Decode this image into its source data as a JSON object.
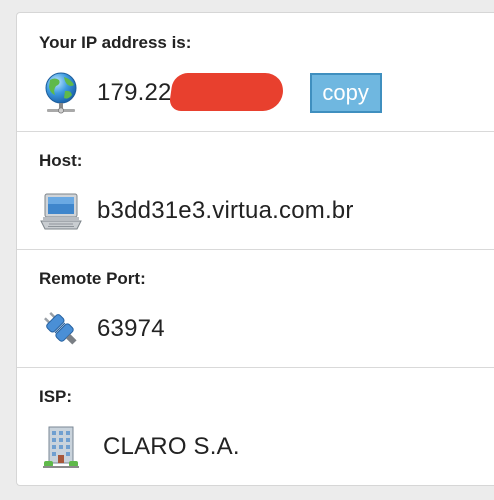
{
  "ip": {
    "label": "Your IP address is:",
    "value": "179.22",
    "copy_label": "copy"
  },
  "host": {
    "label": "Host:",
    "value": "b3dd31e3.virtua.com.br"
  },
  "port": {
    "label": "Remote Port:",
    "value": "63974"
  },
  "isp": {
    "label": "ISP:",
    "value": "CLARO S.A."
  },
  "icons": {
    "ip": "globe-network-icon",
    "host": "laptop-icon",
    "port": "plug-icon",
    "isp": "office-building-icon"
  },
  "colors": {
    "copy_button": "#6fb7e0",
    "redaction": "#e8402e"
  }
}
